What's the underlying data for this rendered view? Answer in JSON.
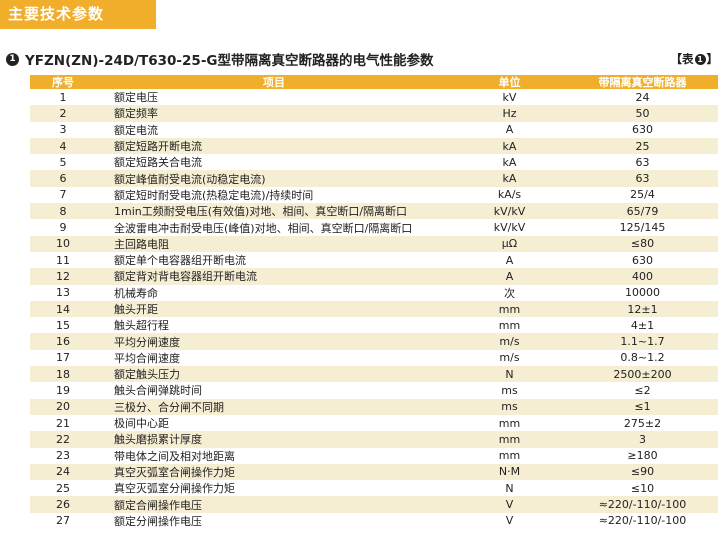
{
  "section": {
    "title": "主要技术参数"
  },
  "table_title": {
    "number": "1",
    "text": "YFZN(ZN)-24D/T630-25-G型带隔离真空断路器的电气性能参数",
    "ref_prefix": "【表",
    "ref_number": "1",
    "ref_suffix": "】"
  },
  "headers": {
    "no": "序号",
    "item": "项目",
    "unit": "单位",
    "value": "带隔离真空断路器"
  },
  "rows": [
    {
      "no": "1",
      "item": "额定电压",
      "unit": "kV",
      "value": "24"
    },
    {
      "no": "2",
      "item": "额定频率",
      "unit": "Hz",
      "value": "50"
    },
    {
      "no": "3",
      "item": "额定电流",
      "unit": "A",
      "value": "630"
    },
    {
      "no": "4",
      "item": "额定短路开断电流",
      "unit": "kA",
      "value": "25"
    },
    {
      "no": "5",
      "item": "额定短路关合电流",
      "unit": "kA",
      "value": "63"
    },
    {
      "no": "6",
      "item": "额定峰值耐受电流(动稳定电流)",
      "unit": "kA",
      "value": "63"
    },
    {
      "no": "7",
      "item": "额定短时耐受电流(热稳定电流)/持续时间",
      "unit": "kA/s",
      "value": "25/4"
    },
    {
      "no": "8",
      "item": "1min工频耐受电压(有效值)对地、相间、真空断口/隔离断口",
      "unit": "kV/kV",
      "value": "65/79"
    },
    {
      "no": "9",
      "item": "全波雷电冲击耐受电压(峰值)对地、相间、真空断口/隔离断口",
      "unit": "kV/kV",
      "value": "125/145"
    },
    {
      "no": "10",
      "item": "主回路电阻",
      "unit": "μΩ",
      "value": "≤80"
    },
    {
      "no": "11",
      "item": "额定单个电容器组开断电流",
      "unit": "A",
      "value": "630"
    },
    {
      "no": "12",
      "item": "额定背对背电容器组开断电流",
      "unit": "A",
      "value": "400"
    },
    {
      "no": "13",
      "item": "机械寿命",
      "unit": "次",
      "value": "10000"
    },
    {
      "no": "14",
      "item": "触头开距",
      "unit": "mm",
      "value": "12±1"
    },
    {
      "no": "15",
      "item": "触头超行程",
      "unit": "mm",
      "value": "4±1"
    },
    {
      "no": "16",
      "item": "平均分闸速度",
      "unit": "m/s",
      "value": "1.1~1.7"
    },
    {
      "no": "17",
      "item": "平均合闸速度",
      "unit": "m/s",
      "value": "0.8~1.2"
    },
    {
      "no": "18",
      "item": "额定触头压力",
      "unit": "N",
      "value": "2500±200"
    },
    {
      "no": "19",
      "item": "触头合闸弹跳时间",
      "unit": "ms",
      "value": "≤2"
    },
    {
      "no": "20",
      "item": "三极分、合分闸不同期",
      "unit": "ms",
      "value": "≤1"
    },
    {
      "no": "21",
      "item": "极间中心距",
      "unit": "mm",
      "value": "275±2"
    },
    {
      "no": "22",
      "item": "触头磨损累计厚度",
      "unit": "mm",
      "value": "3"
    },
    {
      "no": "23",
      "item": "带电体之间及相对地距离",
      "unit": "mm",
      "value": "≥180"
    },
    {
      "no": "24",
      "item": "真空灭弧室合闸操作力矩",
      "unit": "N·M",
      "value": "≤90"
    },
    {
      "no": "25",
      "item": "真空灭弧室分闸操作力矩",
      "unit": "N",
      "value": "≤10"
    },
    {
      "no": "26",
      "item": "额定合闸操作电压",
      "unit": "V",
      "value": "≈220/-110/-100"
    },
    {
      "no": "27",
      "item": "额定分闸操作电压",
      "unit": "V",
      "value": "≈220/-110/-100"
    }
  ],
  "colors": {
    "accent": "#f0ae2b",
    "row_alt": "#f6eed3"
  }
}
